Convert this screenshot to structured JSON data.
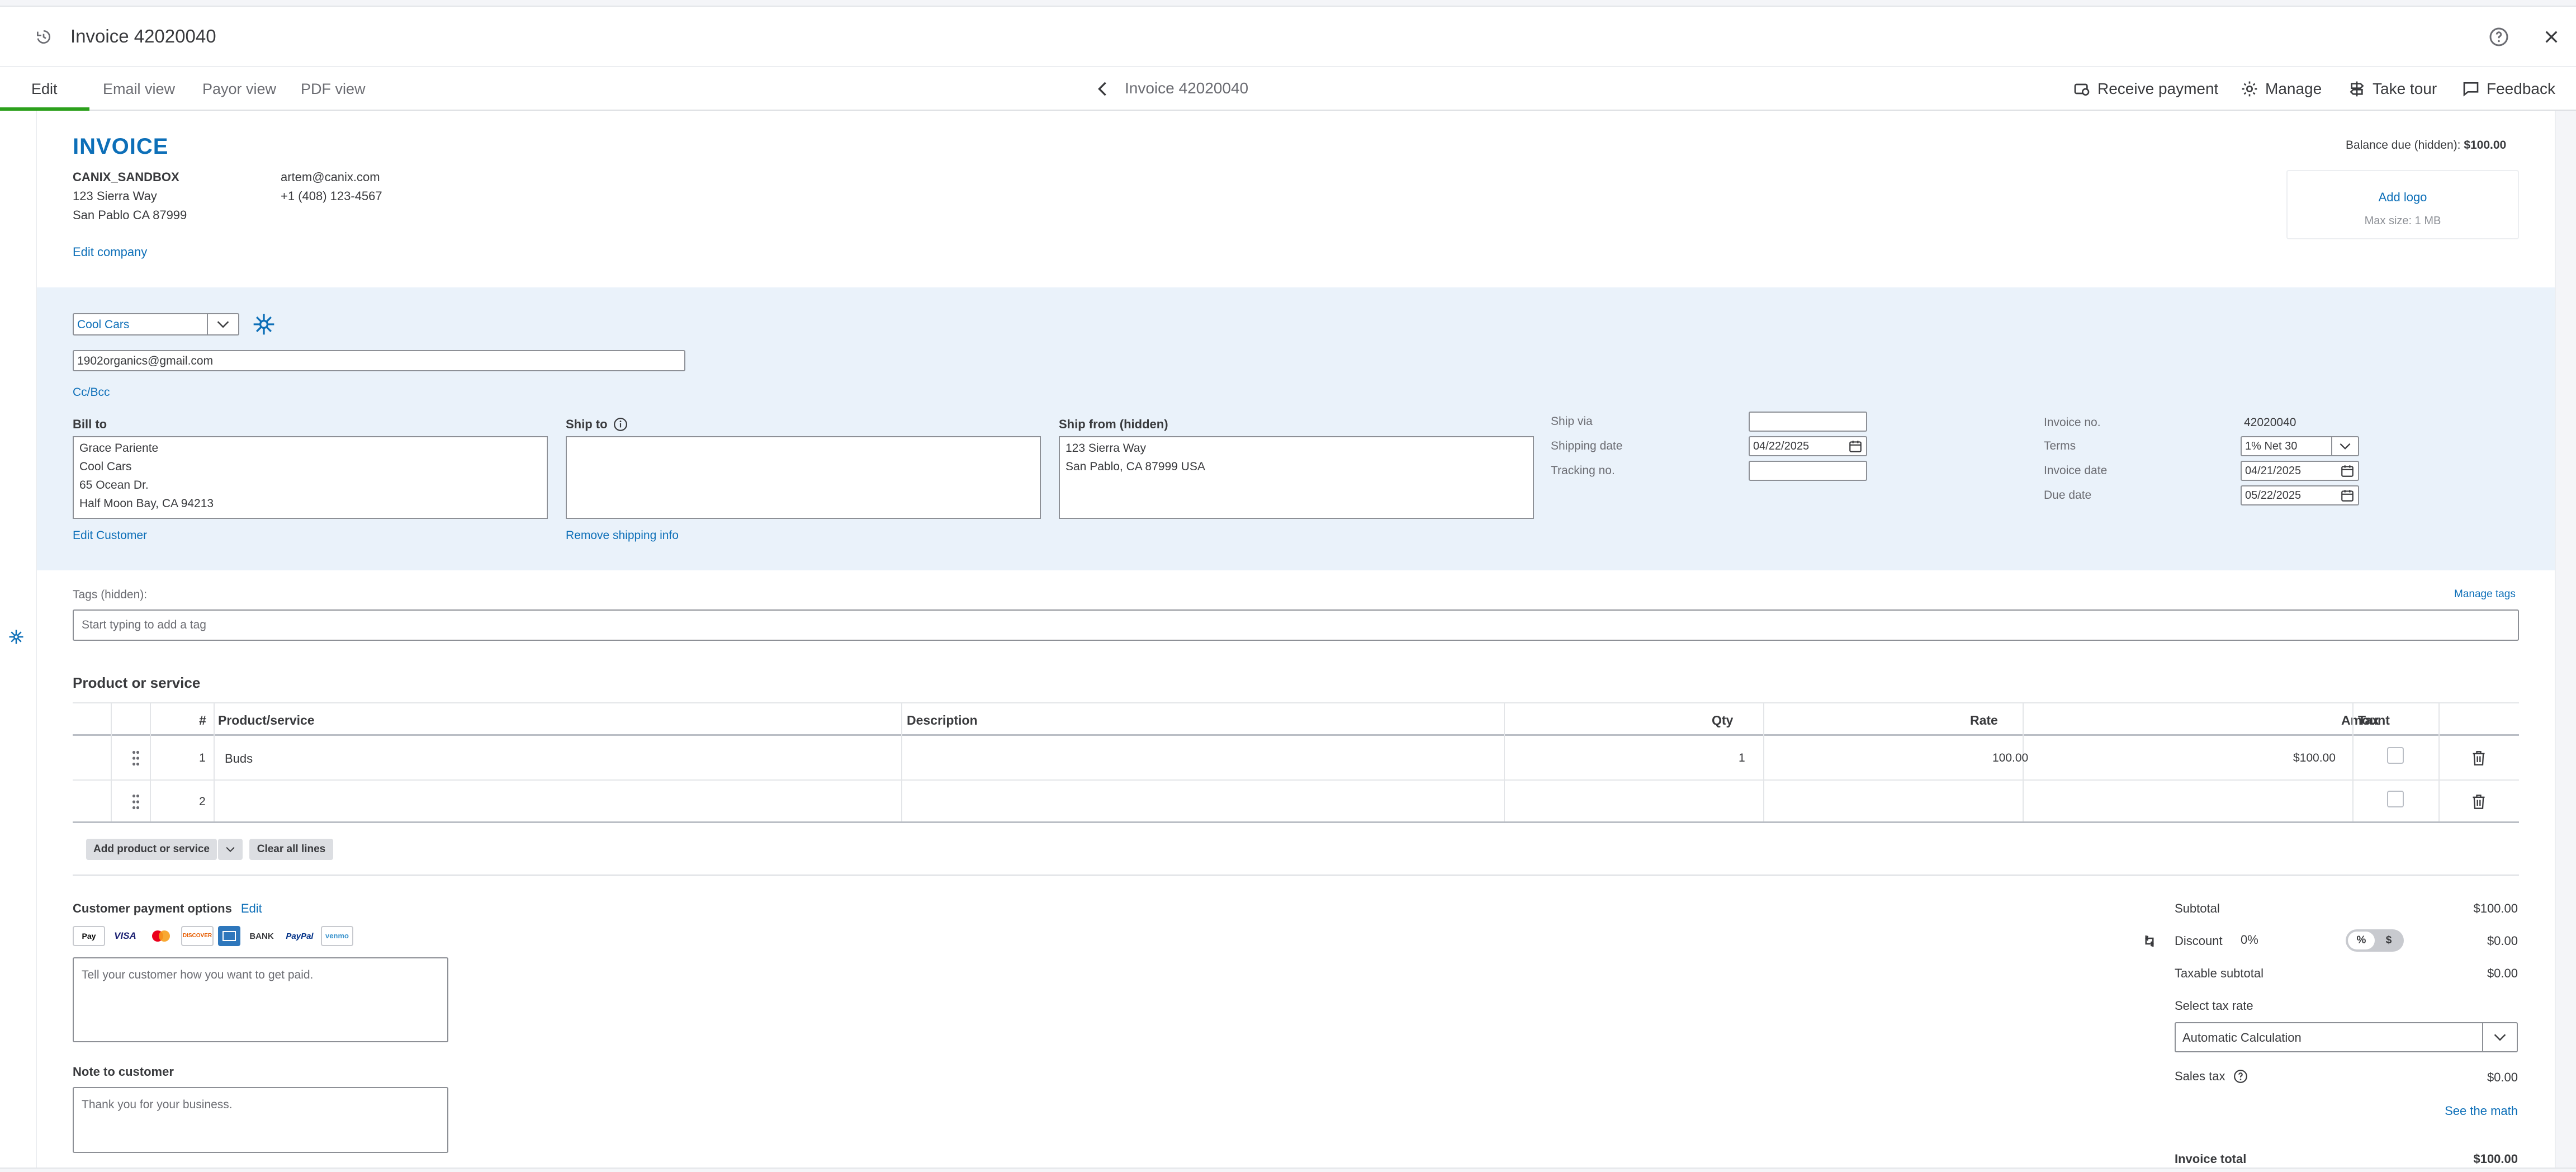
{
  "window": {
    "title": "Invoice 42020040",
    "help_icon": "help-circle-icon",
    "close_icon": "close-icon"
  },
  "tabs": [
    {
      "label": "Edit",
      "active": true
    },
    {
      "label": "Email view",
      "active": false
    },
    {
      "label": "Payor view",
      "active": false
    },
    {
      "label": "PDF view",
      "active": false
    }
  ],
  "nav": {
    "center_title": "Invoice 42020040"
  },
  "toolbar": {
    "receive_payment": "Receive payment",
    "manage": "Manage",
    "take_tour": "Take tour",
    "feedback": "Feedback"
  },
  "header": {
    "invoice_label": "INVOICE",
    "company_name": "CANIX_SANDBOX",
    "address_line1": "123 Sierra Way",
    "address_line2": "San Pablo CA 87999",
    "email": "artem@canix.com",
    "phone": "+1 (408) 123-4567",
    "edit_company": "Edit company",
    "balance_due_label": "Balance due (hidden):",
    "balance_due_value": "$100.00",
    "add_logo": "Add logo",
    "logo_max_size": "Max size: 1 MB"
  },
  "customer": {
    "selected": "Cool Cars",
    "email": "1902organics@gmail.com",
    "cc_bcc": "Cc/Bcc",
    "bill_to_label": "Bill to",
    "bill_to_lines": [
      "Grace Pariente",
      "Cool Cars",
      "65 Ocean Dr.",
      "Half Moon Bay, CA  94213"
    ],
    "edit_customer": "Edit Customer",
    "ship_to_label": "Ship to",
    "remove_shipping": "Remove shipping info",
    "ship_from_label": "Ship from (hidden)",
    "ship_from_lines": [
      "123 Sierra Way",
      "San Pablo, CA  87999 USA"
    ],
    "ship_via_label": "Ship via",
    "ship_via_value": "",
    "shipping_date_label": "Shipping date",
    "shipping_date_value": "04/22/2025",
    "tracking_label": "Tracking no.",
    "tracking_value": "",
    "invoice_no_label": "Invoice no.",
    "invoice_no_value": "42020040",
    "terms_label": "Terms",
    "terms_value": "1% Net 30",
    "invoice_date_label": "Invoice date",
    "invoice_date_value": "04/21/2025",
    "due_date_label": "Due date",
    "due_date_value": "05/22/2025"
  },
  "tags": {
    "label": "Tags (hidden):",
    "manage": "Manage tags",
    "placeholder": "Start typing to add a tag"
  },
  "products": {
    "section_title": "Product or service",
    "columns": {
      "num": "#",
      "product": "Product/service",
      "description": "Description",
      "qty": "Qty",
      "rate": "Rate",
      "amount": "Amount",
      "tax": "Tax"
    },
    "rows": [
      {
        "num": "1",
        "product": "Buds",
        "description": "",
        "qty": "1",
        "rate": "100.00",
        "amount": "$100.00"
      },
      {
        "num": "2",
        "product": "",
        "description": "",
        "qty": "",
        "rate": "",
        "amount": ""
      }
    ],
    "add_button": "Add product or service",
    "clear_button": "Clear all lines"
  },
  "payment": {
    "title": "Customer payment options",
    "edit": "Edit",
    "icons": [
      "Pay",
      "VISA",
      "MC",
      "DISCOVER",
      "AMEX",
      "BANK",
      "PayPal",
      "venmo"
    ],
    "message_placeholder": "Tell your customer how you want to get paid.",
    "note_label": "Note to customer",
    "note_value": "Thank you for your business."
  },
  "totals": {
    "subtotal_label": "Subtotal",
    "subtotal_value": "$100.00",
    "discount_label": "Discount",
    "discount_pct": "0%",
    "discount_toggle_pct": "%",
    "discount_toggle_dollar": "$",
    "discount_value": "$0.00",
    "taxable_label": "Taxable subtotal",
    "taxable_value": "$0.00",
    "tax_rate_label": "Select tax rate",
    "tax_rate_value": "Automatic Calculation",
    "sales_tax_label": "Sales tax",
    "sales_tax_value": "$0.00",
    "see_math": "See the math",
    "invoice_total_label": "Invoice total",
    "invoice_total_value": "$100.00"
  }
}
